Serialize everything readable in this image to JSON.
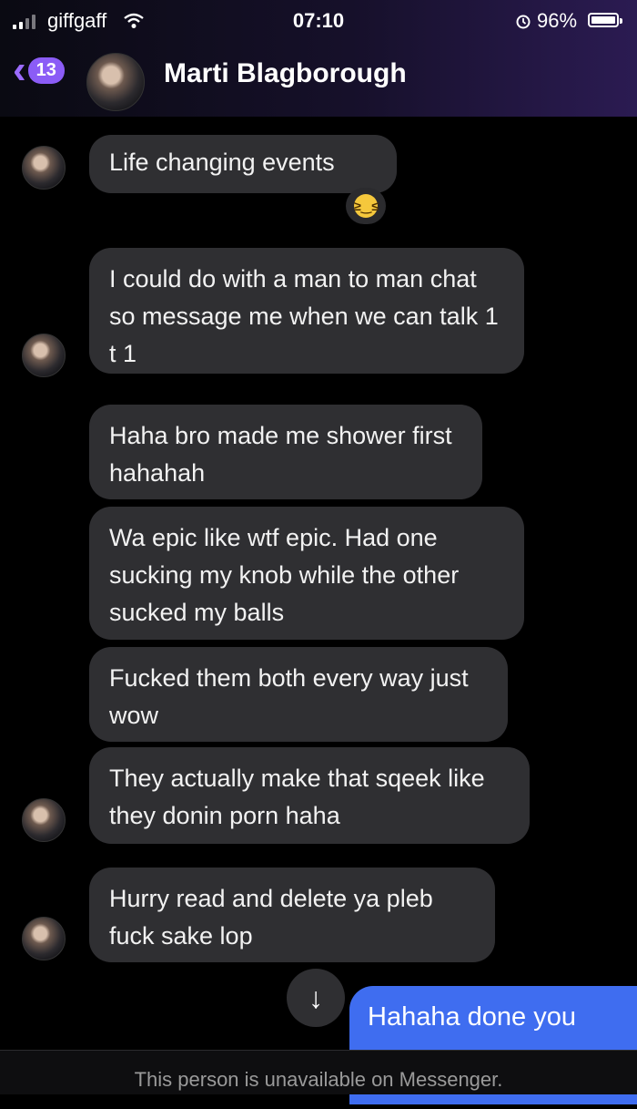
{
  "status_bar": {
    "carrier": "giffgaff",
    "time": "07:10",
    "battery_percent": "96%",
    "battery_level": 0.96,
    "icons": [
      "signal-icon",
      "wifi-icon",
      "alarm-icon",
      "battery-icon"
    ]
  },
  "header": {
    "back_count": "13",
    "contact_name": "Marti Blagborough",
    "accent_color": "#8b5cf6"
  },
  "messages": [
    {
      "text": "Life changing events",
      "reaction": "grinning-squinting-face"
    },
    {
      "text": "I could do with a man to man chat so message me when we can talk 1 t 1"
    },
    {
      "text": "Haha bro made me shower first hahahah"
    },
    {
      "text": "Wa epic like wtf epic. Had one sucking my knob while the other sucked my balls"
    },
    {
      "text": "Fucked them both every way just wow"
    },
    {
      "text": "They actually make that sqeek like they donin porn haha"
    },
    {
      "text": "Hurry read and delete ya pleb fuck sake lop"
    }
  ],
  "sent_message": {
    "text": "Hahaha done you",
    "color": "#3f6df0"
  },
  "scroll_button": {
    "icon": "arrow-down-icon"
  },
  "footer": {
    "text": "This person is unavailable on Messenger."
  }
}
